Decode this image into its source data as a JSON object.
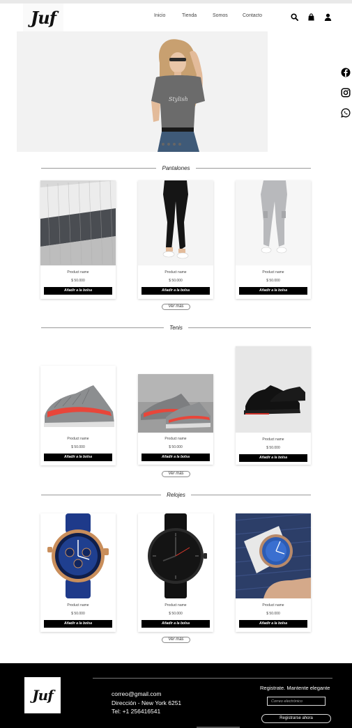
{
  "brand": {
    "logo_text": "Juf"
  },
  "nav": {
    "items": [
      {
        "id": "inicio",
        "label": "Inicio"
      },
      {
        "id": "tienda",
        "label": "Tienda"
      },
      {
        "id": "somos",
        "label": "Somos"
      },
      {
        "id": "contacto",
        "label": "Contacto"
      }
    ],
    "icons": [
      "search-icon",
      "shopping-bag-icon",
      "user-icon"
    ]
  },
  "social": [
    "facebook-icon",
    "instagram-icon",
    "whatsapp-icon"
  ],
  "sections": [
    {
      "id": "pantalones",
      "title": "Pantalones",
      "products": [
        {
          "name": "Product name",
          "price": "$ 50.000",
          "button": "Añadir a la bolsa"
        },
        {
          "name": "Product name",
          "price": "$ 50.000",
          "button": "Añadir a la bolsa"
        },
        {
          "name": "Product name",
          "price": "$ 50.000",
          "button": "Añadir a la bolsa"
        }
      ],
      "more_label": "Ver más"
    },
    {
      "id": "tenis",
      "title": "Tenis",
      "products": [
        {
          "name": "Product name",
          "price": "$ 50.000",
          "button": "Añadir a la bolsa"
        },
        {
          "name": "Product name",
          "price": "$ 50.000",
          "button": "Añadir a la bolsa"
        },
        {
          "name": "Product name",
          "price": "$ 50.000",
          "button": "Añadir a la bolsa"
        }
      ],
      "more_label": "Ver más"
    },
    {
      "id": "relojes",
      "title": "Relojes",
      "products": [
        {
          "name": "Product name",
          "price": "$ 50.000",
          "button": "Añadir a la bolsa"
        },
        {
          "name": "Product name",
          "price": "$ 50.000",
          "button": "Añadir a la bolsa"
        },
        {
          "name": "Product name",
          "price": "$ 50.000",
          "button": "Añadir a la bolsa"
        }
      ],
      "more_label": "Ver más"
    }
  ],
  "footer": {
    "email": "correo@gmail.com",
    "address": "Dirección - New York 6251",
    "phone": "Tel: +1 256416541",
    "signup_title": "Registrate. Mantente elegante",
    "email_placeholder": "Correo electrónico",
    "signup_button": "Registrarse ahora"
  },
  "colors": {
    "accent": "#000000",
    "background": "#ffffff",
    "sneaker_stripe": "#e8463a"
  }
}
